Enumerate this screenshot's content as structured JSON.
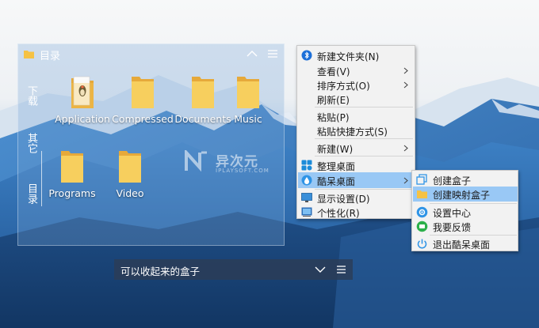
{
  "fence": {
    "title": "目录",
    "side_tabs": [
      "下载",
      "其它",
      "目录"
    ],
    "files": [
      "Application",
      "Compressed",
      "Documents",
      "Music",
      "Programs",
      "Video"
    ]
  },
  "fence2": {
    "title": "可以收起来的盒子"
  },
  "context_menu": {
    "items": [
      {
        "label": "新建文件夹(N)"
      },
      {
        "label": "查看(V)"
      },
      {
        "label": "排序方式(O)"
      },
      {
        "label": "刷新(E)"
      },
      {
        "label": "粘贴(P)"
      },
      {
        "label": "粘贴快捷方式(S)"
      },
      {
        "label": "新建(W)"
      },
      {
        "label": "整理桌面"
      },
      {
        "label": "酷呆桌面"
      },
      {
        "label": "显示设置(D)"
      },
      {
        "label": "个性化(R)"
      }
    ],
    "highlight_color": "#99c8f5"
  },
  "submenu": {
    "items": [
      {
        "label": "创建盒子"
      },
      {
        "label": "创建映射盒子"
      },
      {
        "label": "设置中心"
      },
      {
        "label": "我要反馈"
      },
      {
        "label": "退出酷呆桌面"
      }
    ]
  },
  "watermark": {
    "text": "异次元",
    "sub": "IPLAYSOFT.COM"
  },
  "icons": {
    "folder": "folder-icon",
    "collapse": "chevron-up-icon",
    "expand": "chevron-down-icon",
    "menu": "hamburger-icon",
    "submenu_arrow": "chevron-right-icon"
  }
}
